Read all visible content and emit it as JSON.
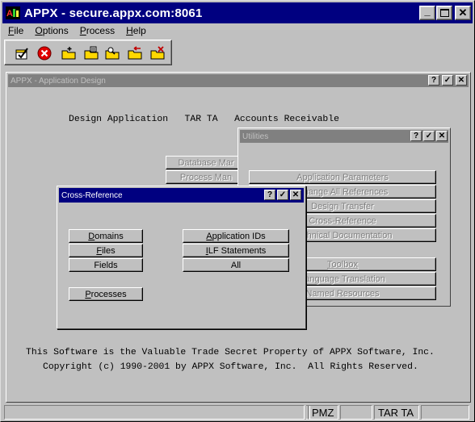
{
  "app": {
    "title": "APPX - secure.appx.com:8061"
  },
  "window_controls": {
    "minimize": "_",
    "maximize": "□",
    "close": "✕"
  },
  "menu": [
    {
      "label": "File",
      "mnemonic": "F",
      "rest": "ile"
    },
    {
      "label": "Options",
      "mnemonic": "O",
      "rest": "ptions"
    },
    {
      "label": "Process",
      "mnemonic": "P",
      "rest": "rocess"
    },
    {
      "label": "Help",
      "mnemonic": "H",
      "rest": "elp"
    }
  ],
  "toolbar": {
    "icons": [
      "check-icon",
      "stop-icon",
      "folder-new-icon",
      "folder-up-icon",
      "folder-search-icon",
      "folder-back-icon",
      "folder-cancel-icon"
    ]
  },
  "design_window": {
    "title": "APPX - Application Design",
    "header": "Design Application   TAR TA   Accounts Receivable",
    "bg_buttons": [
      "Database Mar",
      "Process Man"
    ],
    "footer_line1": "This Software is the Valuable Trade Secret Property of APPX Software, Inc.",
    "footer_line2": "Copyright (c) 1990-2001 by APPX Software, Inc.  All Rights Reserved."
  },
  "utilities_window": {
    "title": "Utilities",
    "buttons": [
      "Application Parameters",
      "Change All References",
      "Design Transfer",
      "Cross-Reference",
      "Technical Documentation",
      "Toolbox",
      "Language Translation",
      "Named Resources"
    ]
  },
  "xref_window": {
    "title": "Cross-Reference",
    "buttons_left": [
      {
        "label": "Domains",
        "mnemonic": "D",
        "rest": "omains"
      },
      {
        "label": "Files",
        "mnemonic": "F",
        "rest": "iles"
      },
      {
        "label": "Fields",
        "mnemonic": "F",
        "rest": "ields",
        "pre": ""
      },
      {
        "label": "Processes",
        "mnemonic": "P",
        "rest": "rocesses"
      }
    ],
    "buttons_right": [
      {
        "label": "Application IDs",
        "mnemonic": "A",
        "rest": "pplication IDs"
      },
      {
        "label": "ILF Statements",
        "mnemonic": "I",
        "rest": "LF Statements"
      },
      {
        "label": "All",
        "mnemonic": "",
        "rest": "All"
      }
    ]
  },
  "dialog_controls": {
    "help": "?",
    "ok": "✓",
    "close": "✕"
  },
  "statusbar": {
    "cells": [
      "",
      "",
      "PMZ",
      "",
      "TAR TA",
      ""
    ]
  },
  "colors": {
    "active_title": "#000080",
    "inactive_title": "#808080",
    "face": "#c0c0c0"
  }
}
